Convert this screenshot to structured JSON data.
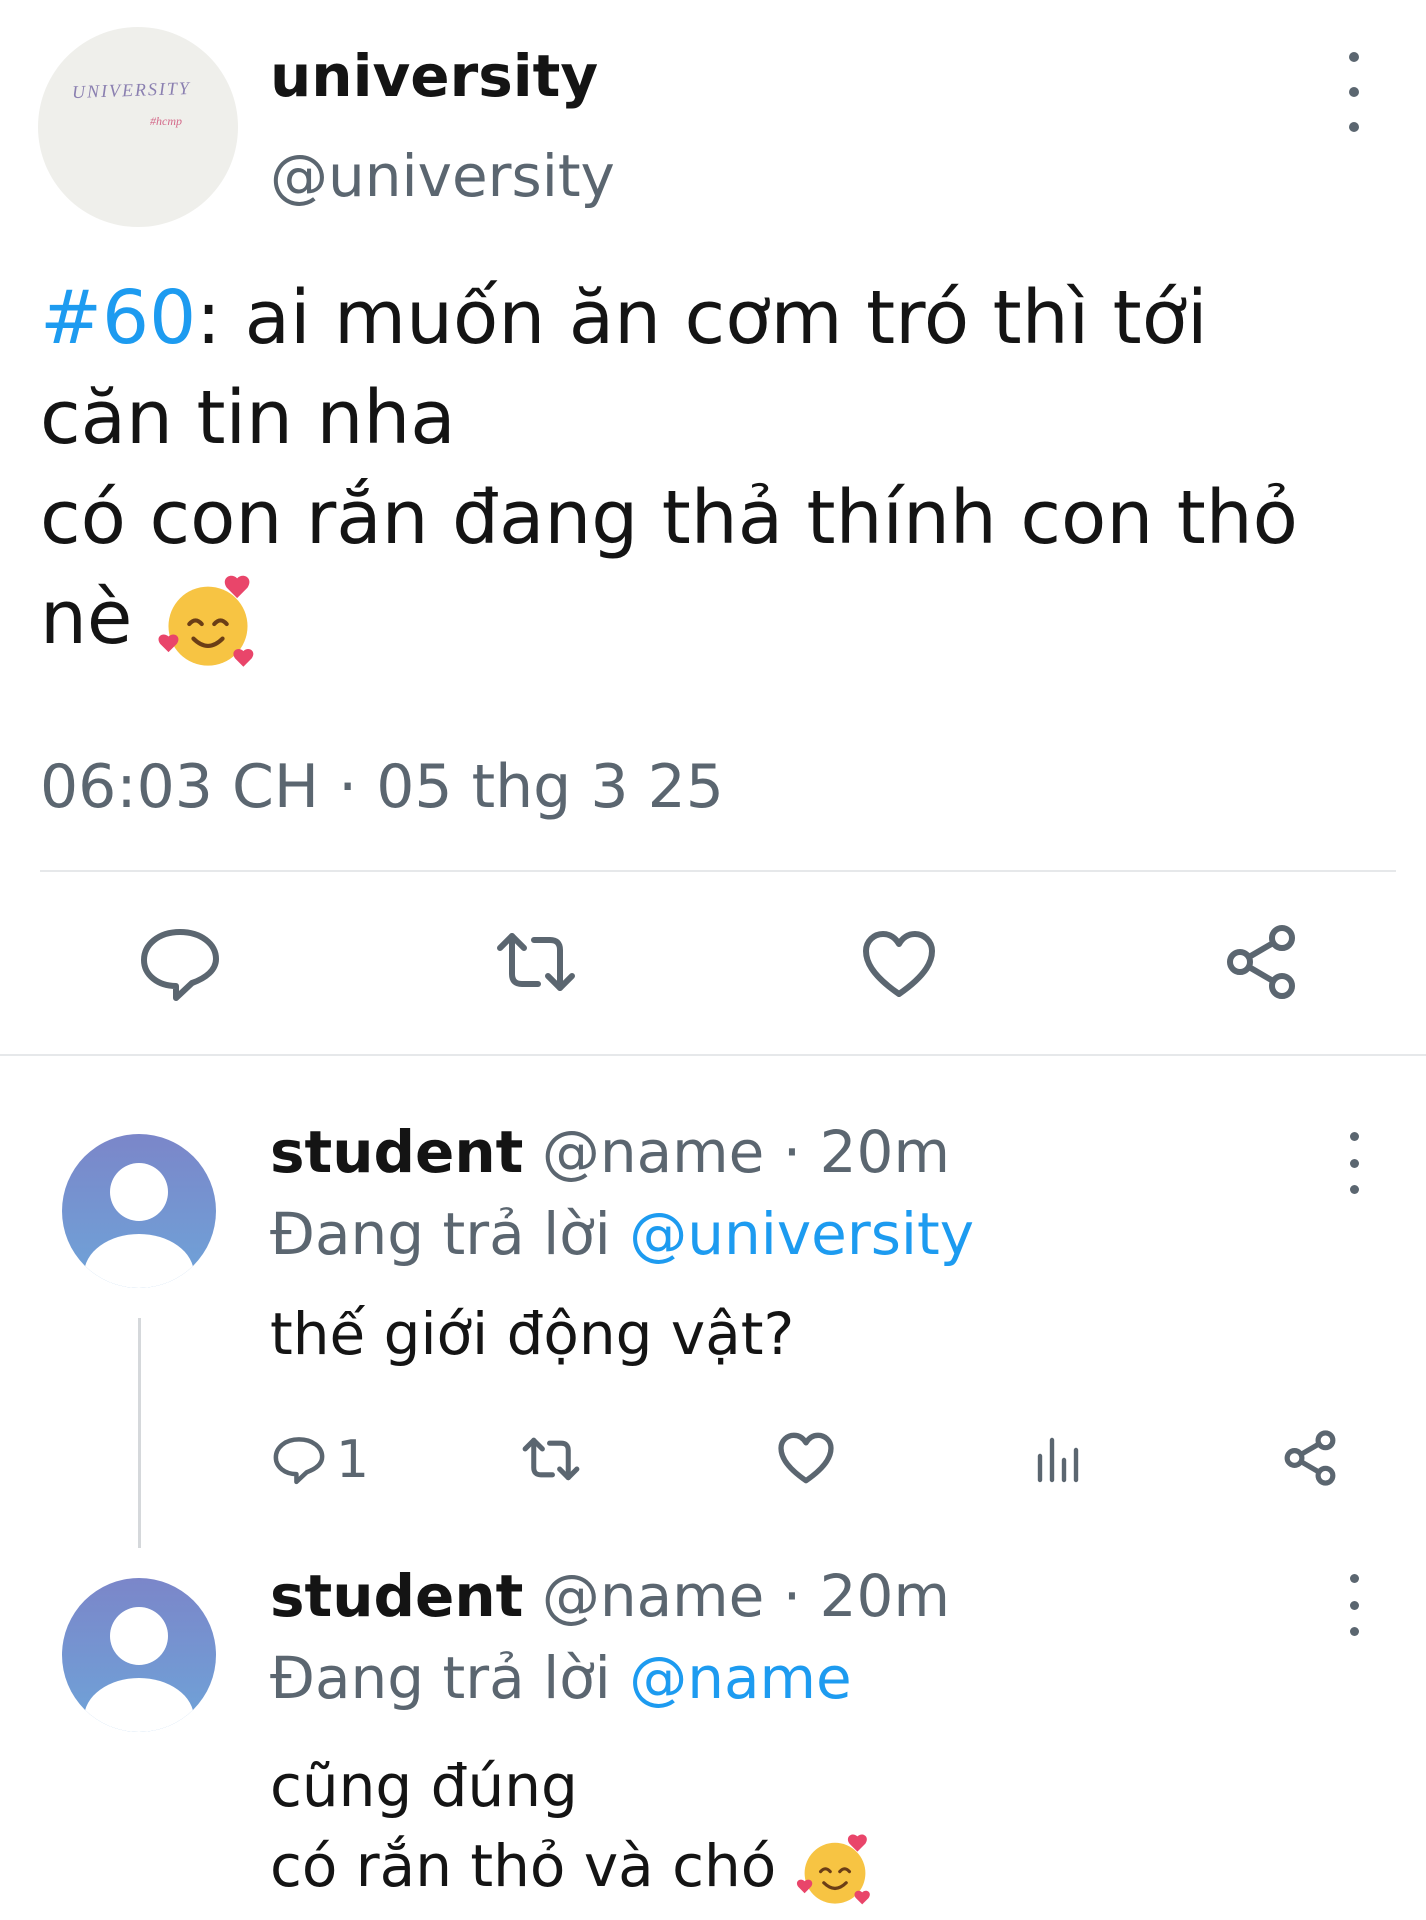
{
  "tweet": {
    "display_name": "university",
    "handle": "@university",
    "avatar_text": "UNIVERSITY",
    "avatar_subtext": "#hcmp",
    "hashtag": "#60",
    "text_after_hashtag": ": ai muốn ăn cơm tró thì tới",
    "line2": "căn tin nha",
    "line3": "có con rắn đang thả thính con thỏ",
    "line4": "nè",
    "timestamp": "06:03 CH · 05 thg 3 25"
  },
  "actions": {
    "reply_icon": "reply-icon",
    "retweet_icon": "retweet-icon",
    "like_icon": "heart-icon",
    "share_icon": "share-icon"
  },
  "replies": [
    {
      "name": "student",
      "handle_time": "@name · 20m",
      "replying_label": "Đang trả lời",
      "replying_to": "@university",
      "text_lines": [
        "thế giới động vật?"
      ],
      "reply_count": "1"
    },
    {
      "name": "student",
      "handle_time": "@name · 20m",
      "replying_label": "Đang trả lời",
      "replying_to": "@name",
      "text_lines": [
        "cũng đúng",
        "có rắn thỏ và chó"
      ]
    }
  ],
  "colors": {
    "accent": "#1d9bf0",
    "muted": "#5b6670",
    "text": "#141414"
  }
}
